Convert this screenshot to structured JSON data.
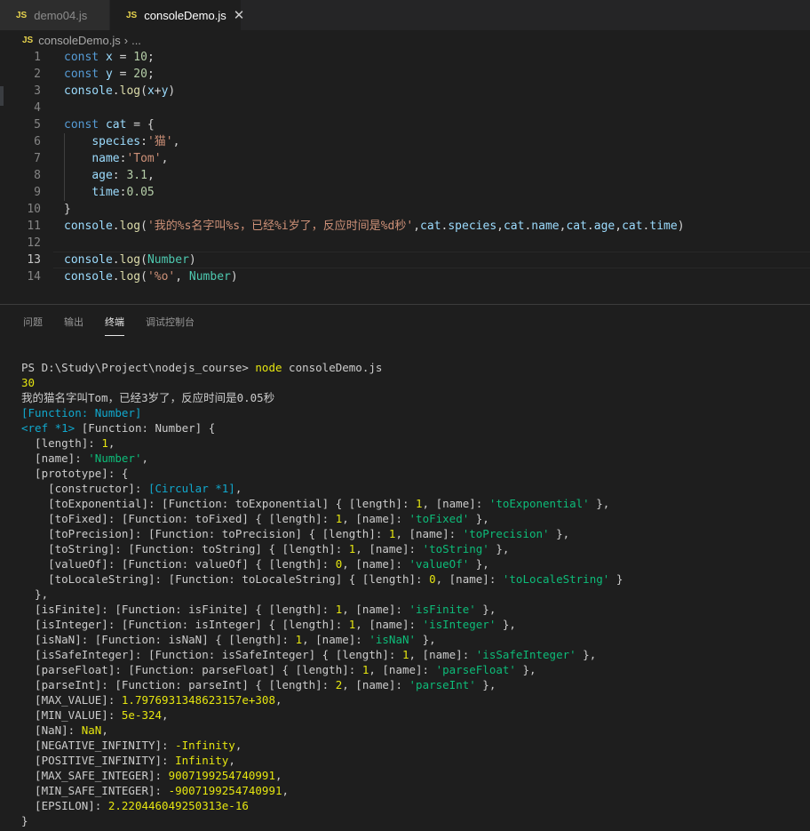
{
  "tabs": [
    {
      "badge": "JS",
      "label": "demo04.js",
      "active": false
    },
    {
      "badge": "JS",
      "label": "consoleDemo.js",
      "active": true,
      "close": "✕"
    }
  ],
  "breadcrumb": {
    "badge": "JS",
    "file": "consoleDemo.js",
    "sep": "›",
    "rest": "..."
  },
  "editor": {
    "line_numbers": [
      "1",
      "2",
      "3",
      "4",
      "5",
      "6",
      "7",
      "8",
      "9",
      "10",
      "11",
      "12",
      "13",
      "14"
    ],
    "current_line": 13,
    "lines": [
      [
        [
          "k",
          "const "
        ],
        [
          "v",
          "x"
        ],
        [
          "p",
          " = "
        ],
        [
          "n",
          "10"
        ],
        [
          "p",
          ";"
        ]
      ],
      [
        [
          "k",
          "const "
        ],
        [
          "v",
          "y"
        ],
        [
          "p",
          " = "
        ],
        [
          "n",
          "20"
        ],
        [
          "p",
          ";"
        ]
      ],
      [
        [
          "v",
          "console"
        ],
        [
          "p",
          "."
        ],
        [
          "f",
          "log"
        ],
        [
          "p",
          "("
        ],
        [
          "v",
          "x"
        ],
        [
          "p",
          "+"
        ],
        [
          "v",
          "y"
        ],
        [
          "p",
          ")"
        ]
      ],
      [],
      [
        [
          "k",
          "const "
        ],
        [
          "v",
          "cat"
        ],
        [
          "p",
          " = {"
        ]
      ],
      [
        [
          "p",
          "    "
        ],
        [
          "v",
          "species"
        ],
        [
          "p",
          ":"
        ],
        [
          "s",
          "'猫'"
        ],
        [
          "p",
          ","
        ]
      ],
      [
        [
          "p",
          "    "
        ],
        [
          "v",
          "name"
        ],
        [
          "p",
          ":"
        ],
        [
          "s",
          "'Tom'"
        ],
        [
          "p",
          ","
        ]
      ],
      [
        [
          "p",
          "    "
        ],
        [
          "v",
          "age"
        ],
        [
          "p",
          ": "
        ],
        [
          "n",
          "3.1"
        ],
        [
          "p",
          ","
        ]
      ],
      [
        [
          "p",
          "    "
        ],
        [
          "v",
          "time"
        ],
        [
          "p",
          ":"
        ],
        [
          "n",
          "0.05"
        ]
      ],
      [
        [
          "p",
          "}"
        ]
      ],
      [
        [
          "v",
          "console"
        ],
        [
          "p",
          "."
        ],
        [
          "f",
          "log"
        ],
        [
          "p",
          "("
        ],
        [
          "s",
          "'我的%s名字叫%s，已经%i岁了，反应时间是%d秒'"
        ],
        [
          "p",
          ","
        ],
        [
          "v",
          "cat"
        ],
        [
          "p",
          "."
        ],
        [
          "v",
          "species"
        ],
        [
          "p",
          ","
        ],
        [
          "v",
          "cat"
        ],
        [
          "p",
          "."
        ],
        [
          "v",
          "name"
        ],
        [
          "p",
          ","
        ],
        [
          "v",
          "cat"
        ],
        [
          "p",
          "."
        ],
        [
          "v",
          "age"
        ],
        [
          "p",
          ","
        ],
        [
          "v",
          "cat"
        ],
        [
          "p",
          "."
        ],
        [
          "v",
          "time"
        ],
        [
          "p",
          ")"
        ]
      ],
      [],
      [
        [
          "v",
          "console"
        ],
        [
          "p",
          "."
        ],
        [
          "f",
          "log"
        ],
        [
          "p",
          "("
        ],
        [
          "t",
          "Number"
        ],
        [
          "p",
          ")"
        ]
      ],
      [
        [
          "v",
          "console"
        ],
        [
          "p",
          "."
        ],
        [
          "f",
          "log"
        ],
        [
          "p",
          "("
        ],
        [
          "s",
          "'%o'"
        ],
        [
          "p",
          ", "
        ],
        [
          "t",
          "Number"
        ],
        [
          "p",
          ")"
        ]
      ]
    ]
  },
  "panel": {
    "tabs": [
      "问题",
      "输出",
      "终端",
      "调试控制台"
    ],
    "active_tab": "终端"
  },
  "terminal": {
    "lines": [
      [
        [
          "w",
          "PS D:\\Study\\Project\\nodejs_course> "
        ],
        [
          "y",
          "node"
        ],
        [
          "w",
          " consoleDemo.js"
        ]
      ],
      [
        [
          "y",
          "30"
        ]
      ],
      [
        [
          "w",
          "我的猫名字叫Tom，已经3岁了，反应时间是0.05秒"
        ]
      ],
      [
        [
          "cy",
          "[Function: Number]"
        ]
      ],
      [
        [
          "cy",
          "<ref *1>"
        ],
        [
          "w",
          " [Function: Number] {"
        ]
      ],
      [
        [
          "w",
          "  [length]: "
        ],
        [
          "y",
          "1"
        ],
        [
          "w",
          ","
        ]
      ],
      [
        [
          "w",
          "  [name]: "
        ],
        [
          "g",
          "'Number'"
        ],
        [
          "w",
          ","
        ]
      ],
      [
        [
          "w",
          "  [prototype]: {"
        ]
      ],
      [
        [
          "w",
          "    [constructor]: "
        ],
        [
          "cy",
          "[Circular *1]"
        ],
        [
          "w",
          ","
        ]
      ],
      [
        [
          "w",
          "    [toExponential]: [Function: toExponential] { [length]: "
        ],
        [
          "y",
          "1"
        ],
        [
          "w",
          ", [name]: "
        ],
        [
          "g",
          "'toExponential'"
        ],
        [
          "w",
          " },"
        ]
      ],
      [
        [
          "w",
          "    [toFixed]: [Function: toFixed] { [length]: "
        ],
        [
          "y",
          "1"
        ],
        [
          "w",
          ", [name]: "
        ],
        [
          "g",
          "'toFixed'"
        ],
        [
          "w",
          " },"
        ]
      ],
      [
        [
          "w",
          "    [toPrecision]: [Function: toPrecision] { [length]: "
        ],
        [
          "y",
          "1"
        ],
        [
          "w",
          ", [name]: "
        ],
        [
          "g",
          "'toPrecision'"
        ],
        [
          "w",
          " },"
        ]
      ],
      [
        [
          "w",
          "    [toString]: [Function: toString] { [length]: "
        ],
        [
          "y",
          "1"
        ],
        [
          "w",
          ", [name]: "
        ],
        [
          "g",
          "'toString'"
        ],
        [
          "w",
          " },"
        ]
      ],
      [
        [
          "w",
          "    [valueOf]: [Function: valueOf] { [length]: "
        ],
        [
          "y",
          "0"
        ],
        [
          "w",
          ", [name]: "
        ],
        [
          "g",
          "'valueOf'"
        ],
        [
          "w",
          " },"
        ]
      ],
      [
        [
          "w",
          "    [toLocaleString]: [Function: toLocaleString] { [length]: "
        ],
        [
          "y",
          "0"
        ],
        [
          "w",
          ", [name]: "
        ],
        [
          "g",
          "'toLocaleString'"
        ],
        [
          "w",
          " }"
        ]
      ],
      [
        [
          "w",
          "  },"
        ]
      ],
      [
        [
          "w",
          "  [isFinite]: [Function: isFinite] { [length]: "
        ],
        [
          "y",
          "1"
        ],
        [
          "w",
          ", [name]: "
        ],
        [
          "g",
          "'isFinite'"
        ],
        [
          "w",
          " },"
        ]
      ],
      [
        [
          "w",
          "  [isInteger]: [Function: isInteger] { [length]: "
        ],
        [
          "y",
          "1"
        ],
        [
          "w",
          ", [name]: "
        ],
        [
          "g",
          "'isInteger'"
        ],
        [
          "w",
          " },"
        ]
      ],
      [
        [
          "w",
          "  [isNaN]: [Function: isNaN] { [length]: "
        ],
        [
          "y",
          "1"
        ],
        [
          "w",
          ", [name]: "
        ],
        [
          "g",
          "'isNaN'"
        ],
        [
          "w",
          " },"
        ]
      ],
      [
        [
          "w",
          "  [isSafeInteger]: [Function: isSafeInteger] { [length]: "
        ],
        [
          "y",
          "1"
        ],
        [
          "w",
          ", [name]: "
        ],
        [
          "g",
          "'isSafeInteger'"
        ],
        [
          "w",
          " },"
        ]
      ],
      [
        [
          "w",
          "  [parseFloat]: [Function: parseFloat] { [length]: "
        ],
        [
          "y",
          "1"
        ],
        [
          "w",
          ", [name]: "
        ],
        [
          "g",
          "'parseFloat'"
        ],
        [
          "w",
          " },"
        ]
      ],
      [
        [
          "w",
          "  [parseInt]: [Function: parseInt] { [length]: "
        ],
        [
          "y",
          "2"
        ],
        [
          "w",
          ", [name]: "
        ],
        [
          "g",
          "'parseInt'"
        ],
        [
          "w",
          " },"
        ]
      ],
      [
        [
          "w",
          "  [MAX_VALUE]: "
        ],
        [
          "y",
          "1.7976931348623157e+308"
        ],
        [
          "w",
          ","
        ]
      ],
      [
        [
          "w",
          "  [MIN_VALUE]: "
        ],
        [
          "y",
          "5e-324"
        ],
        [
          "w",
          ","
        ]
      ],
      [
        [
          "w",
          "  [NaN]: "
        ],
        [
          "y",
          "NaN"
        ],
        [
          "w",
          ","
        ]
      ],
      [
        [
          "w",
          "  [NEGATIVE_INFINITY]: "
        ],
        [
          "y",
          "-Infinity"
        ],
        [
          "w",
          ","
        ]
      ],
      [
        [
          "w",
          "  [POSITIVE_INFINITY]: "
        ],
        [
          "y",
          "Infinity"
        ],
        [
          "w",
          ","
        ]
      ],
      [
        [
          "w",
          "  [MAX_SAFE_INTEGER]: "
        ],
        [
          "y",
          "9007199254740991"
        ],
        [
          "w",
          ","
        ]
      ],
      [
        [
          "w",
          "  [MIN_SAFE_INTEGER]: "
        ],
        [
          "y",
          "-9007199254740991"
        ],
        [
          "w",
          ","
        ]
      ],
      [
        [
          "w",
          "  [EPSILON]: "
        ],
        [
          "y",
          "2.220446049250313e-16"
        ]
      ],
      [
        [
          "w",
          "}"
        ]
      ]
    ]
  }
}
